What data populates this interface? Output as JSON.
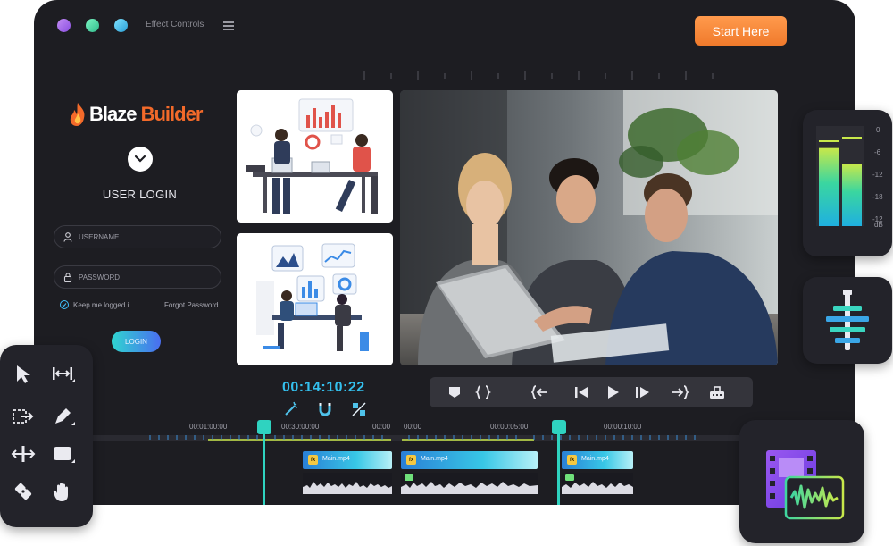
{
  "window": {
    "title": "Effect Controls",
    "cta_label": "Start Here"
  },
  "login": {
    "brand_word_1": "Blaze",
    "brand_word_2": "Builder",
    "title": "USER LOGIN",
    "username_placeholder": "USERNAME",
    "password_placeholder": "PASSWORD",
    "keep_logged_in": "Keep me logged i",
    "forgot_password": "Forgot Password",
    "login_button": "LOGIN"
  },
  "editor": {
    "timecode": "00:14:10:22",
    "timeline_labels": [
      "00:01:00:00",
      "00:30:00:00",
      "00:00",
      "00:00",
      "00:00:05:00",
      "00:00:10:00"
    ],
    "clips": [
      {
        "label": "Main.mp4",
        "badge": "fx"
      },
      {
        "label": "Main.mp4",
        "badge": "fx"
      },
      {
        "label": "Main.mp4",
        "badge": "fx"
      }
    ]
  },
  "audio_meter": {
    "scale": [
      "0",
      "-6",
      "-12",
      "-18",
      "-12",
      "dB"
    ],
    "levels": [
      0.78,
      0.62
    ]
  },
  "icons": {
    "transport": [
      "marker-icon",
      "bracket-in-out-icon",
      "go-to-in-icon",
      "step-back-icon",
      "play-icon",
      "step-forward-icon",
      "go-to-out-icon",
      "export-frame-icon"
    ],
    "tools": [
      "selection-arrow-icon",
      "ripple-edit-icon",
      "track-select-icon",
      "pen-icon",
      "slip-icon",
      "rectangle-icon",
      "razor-icon",
      "hand-icon"
    ]
  },
  "colors": {
    "accent_cyan": "#2fd3c0",
    "timecode_blue": "#34c0ee",
    "cta_orange": "#f07a2c",
    "brand_orange": "#f36a2a"
  }
}
